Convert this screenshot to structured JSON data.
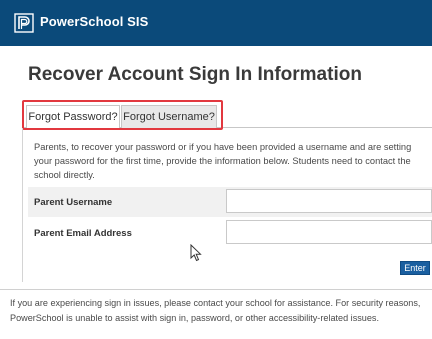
{
  "header": {
    "brand": "PowerSchool SIS",
    "bar_color": "#0b4a7a",
    "logo_icon": "powerschool-p-logo"
  },
  "page": {
    "title": "Recover Account Sign In Information"
  },
  "tabs": [
    {
      "label": "Forgot Password?",
      "active": true
    },
    {
      "label": "Forgot Username?",
      "active": false
    }
  ],
  "highlight_color": "#e2383f",
  "intro": "Parents, to recover your password or if you have been provided a username and are setting your password for the first time, provide the information below. Students need to contact the school directly.",
  "form": {
    "username_label": "Parent Username",
    "username_value": "",
    "email_label": "Parent Email Address",
    "email_value": "",
    "submit_label": "Enter"
  },
  "footer": {
    "text": "If you are experiencing sign in issues, please contact your school for assistance. For security reasons, PowerSchool is unable to assist with sign in, password, or other accessibility-related issues."
  }
}
